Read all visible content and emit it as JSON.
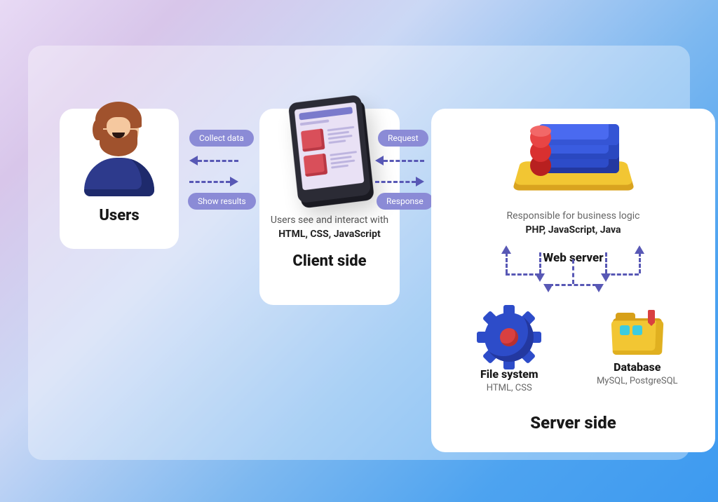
{
  "users": {
    "title": "Users"
  },
  "arrows1": {
    "top": "Collect data",
    "bottom": "Show results"
  },
  "client": {
    "desc_1": "Users see and interact with",
    "desc_2": "HTML, CSS, JavaScript",
    "title": "Client side"
  },
  "arrows2": {
    "top": "Request",
    "bottom": "Response"
  },
  "server": {
    "desc": "Responsible for business logic",
    "langs": "PHP, JavaScript, Java",
    "web_server": "Web server",
    "file_system": {
      "title": "File system",
      "sub": "HTML, CSS"
    },
    "database": {
      "title": "Database",
      "sub": "MySQL, PostgreSQL"
    },
    "title": "Server side"
  }
}
